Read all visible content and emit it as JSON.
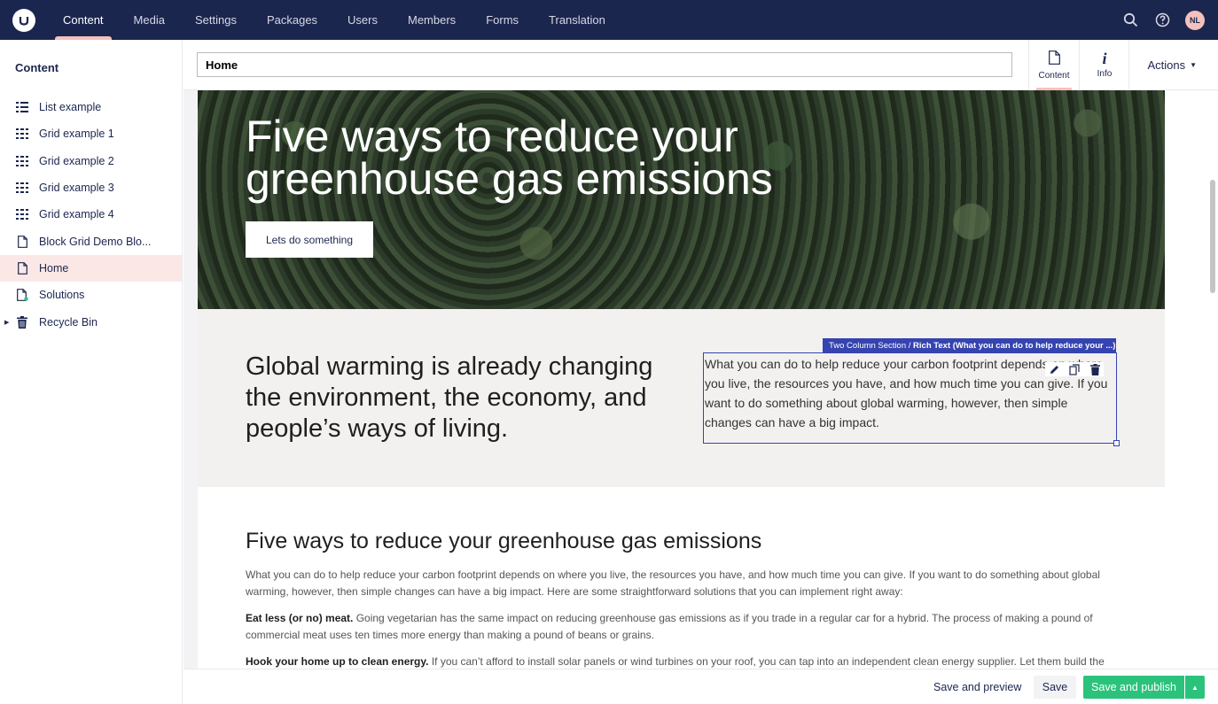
{
  "topnav": {
    "items": [
      {
        "label": "Content",
        "active": true
      },
      {
        "label": "Media"
      },
      {
        "label": "Settings"
      },
      {
        "label": "Packages"
      },
      {
        "label": "Users"
      },
      {
        "label": "Members"
      },
      {
        "label": "Forms"
      },
      {
        "label": "Translation"
      }
    ],
    "avatar_initials": "NL",
    "icons": [
      "search-icon",
      "help-icon"
    ]
  },
  "sidebar": {
    "title": "Content",
    "items": [
      {
        "label": "List example",
        "icon": "grid-icon"
      },
      {
        "label": "Grid example 1",
        "icon": "grid-icon"
      },
      {
        "label": "Grid example 2",
        "icon": "grid-icon"
      },
      {
        "label": "Grid example 3",
        "icon": "grid-icon"
      },
      {
        "label": "Grid example 4",
        "icon": "grid-icon"
      },
      {
        "label": "Block Grid Demo Blo...",
        "icon": "document-icon"
      },
      {
        "label": "Home",
        "icon": "document-icon",
        "selected": true
      },
      {
        "label": "Solutions",
        "icon": "document-icon"
      },
      {
        "label": "Recycle Bin",
        "icon": "trash-icon"
      }
    ]
  },
  "header": {
    "node_name": "Home",
    "apps": [
      {
        "label": "Content",
        "icon": "document-icon",
        "active": true
      },
      {
        "label": "Info",
        "icon": "info-icon"
      }
    ],
    "actions_label": "Actions"
  },
  "hero": {
    "title": "Five ways to reduce your greenhouse gas emissions",
    "button_label": "Lets do something"
  },
  "two_column": {
    "left_text": "Global warming is already changing the environment, the economy, and people’s ways of living.",
    "label_prefix": "Two Column Section /",
    "label_block": "Rich Text (What you can do to help reduce your ...)",
    "rich_text": "What you can do to help reduce your carbon footprint depends on where you live, the resources you have, and how much time you can give. If you want to do something about global warming, however, then simple changes can have a big impact."
  },
  "article": {
    "heading": "Five ways to reduce your greenhouse gas emissions",
    "intro": "What you can do to help reduce your carbon footprint depends on where you live, the resources you have, and how much time you can give. If you want to do something about global warming, however, then simple changes can have a big impact. Here are some straightforward solutions that you can implement right away:",
    "p1_bold": "Eat less (or no) meat.",
    "p1_text": " Going vegetarian has the same impact on reducing greenhouse gas emissions as if you trade in a regular car for a hybrid. The process of making a pound of commercial meat uses ten times more energy than making a pound of beans or grains.",
    "p2_bold": "Hook your home up to clean energy.",
    "p2_text": " If you can’t afford to install solar panels or wind turbines on your roof, you can tap into an independent clean energy supplier. Let them build the"
  },
  "footer": {
    "preview_label": "Save and preview",
    "save_label": "Save",
    "publish_label": "Save and publish"
  },
  "colors": {
    "topbar": "#1b264f",
    "accent": "#f5c1bc",
    "publish": "#2bc37c",
    "block_highlight": "#3544b1"
  }
}
